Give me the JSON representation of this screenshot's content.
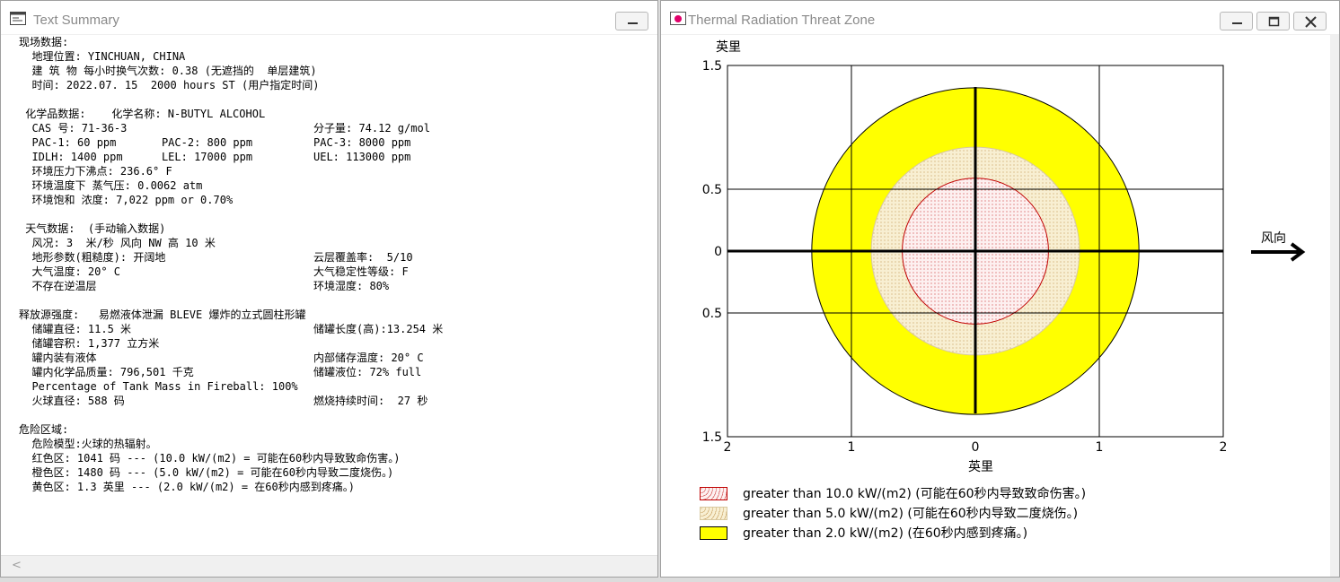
{
  "left_window": {
    "title": "Text Summary",
    "lines_left": [
      "现场数据:",
      "  地理位置: YINCHUAN, CHINA",
      "  建 筑 物 每小时换气次数: 0.38 (无遮挡的  单层建筑)",
      "  时间: 2022.07. 15  2000 hours ST (用户指定时间)",
      "",
      " 化学品数据:    化学名称: N-BUTYL ALCOHOL",
      "  CAS 号: 71-36-3",
      "  PAC-1: 60 ppm       PAC-2: 800 ppm",
      "  IDLH: 1400 ppm      LEL: 17000 ppm",
      "  环境压力下沸点: 236.6° F",
      "  环境温度下 蒸气压: 0.0062 atm",
      "  环境饱和 浓度: 7,022 ppm or 0.70%",
      "",
      " 天气数据:  (手动输入数据)",
      "  风况: 3  米/秒 风向 NW 高 10 米",
      "  地形参数(粗糙度): 开阔地",
      "  大气温度: 20° C",
      "  不存在逆温层",
      "",
      "释放源强度:   易燃液体泄漏 BLEVE 爆炸的立式圆柱形罐",
      "  储罐直径: 11.5 米",
      "  储罐容积: 1,377 立方米",
      "  罐内装有液体",
      "  罐内化学品质量: 796,501 千克",
      "  Percentage of Tank Mass in Fireball: 100%",
      "  火球直径: 588 码",
      "",
      "危险区域:",
      "  危险模型:火球的热辐射。",
      "  红色区: 1041 码 --- (10.0 kW/(m2) = 可能在60秒内导致致命伤害。)",
      "  橙色区: 1480 码 --- (5.0 kW/(m2) = 可能在60秒内导致二度烧伤。)",
      "  黄色区: 1.3 英里 --- (2.0 kW/(m2) = 在60秒内感到疼痛。)"
    ],
    "lines_right": [
      {
        "row": 6,
        "text": "分子量: 74.12 g/mol"
      },
      {
        "row": 7,
        "text": "PAC-3: 8000 ppm"
      },
      {
        "row": 8,
        "text": "UEL: 113000 ppm"
      },
      {
        "row": 15,
        "text": "云层覆盖率:  5/10"
      },
      {
        "row": 16,
        "text": "大气稳定性等级: F"
      },
      {
        "row": 17,
        "text": "环境湿度: 80%"
      },
      {
        "row": 20,
        "text": "储罐长度(高):13.254 米"
      },
      {
        "row": 22,
        "text": "内部储存温度: 20° C"
      },
      {
        "row": 23,
        "text": "储罐液位: 72% full"
      },
      {
        "row": 25,
        "text": "燃烧持续时间:  27 秒"
      }
    ]
  },
  "right_window": {
    "title": "Thermal Radiation Threat Zone",
    "ylabel": "英里",
    "xlabel": "英里",
    "wind_label": "风向",
    "y_ticks": [
      "1.5",
      "0.5",
      "0",
      "0.5",
      "1.5"
    ],
    "x_ticks": [
      "2",
      "1",
      "0",
      "1",
      "2"
    ],
    "legend": [
      {
        "label": "greater than 10.0 kW/(m2) (可能在60秒内导致致命伤害。)",
        "color": "#fbe8e8"
      },
      {
        "label": "greater than 5.0 kW/(m2) (可能在60秒内导致二度烧伤。)",
        "color": "#f7ebc8"
      },
      {
        "label": "greater than 2.0 kW/(m2) (在60秒内感到疼痛。)",
        "color": "#ffff00"
      }
    ]
  },
  "chart_data": {
    "type": "scatter",
    "title": "Thermal Radiation Threat Zone",
    "xlabel": "英里",
    "ylabel": "英里",
    "xlim": [
      -2,
      2
    ],
    "ylim": [
      -1.5,
      1.5
    ],
    "grid": true,
    "zones": [
      {
        "name": "greater than 2.0 kW/(m2)",
        "radius_miles": 1.32,
        "color": "#ffff00"
      },
      {
        "name": "greater than 5.0 kW/(m2)",
        "radius_miles": 0.84,
        "color": "#f7ebc8"
      },
      {
        "name": "greater than 10.0 kW/(m2)",
        "radius_miles": 0.59,
        "color": "#fbe8e8"
      }
    ]
  }
}
